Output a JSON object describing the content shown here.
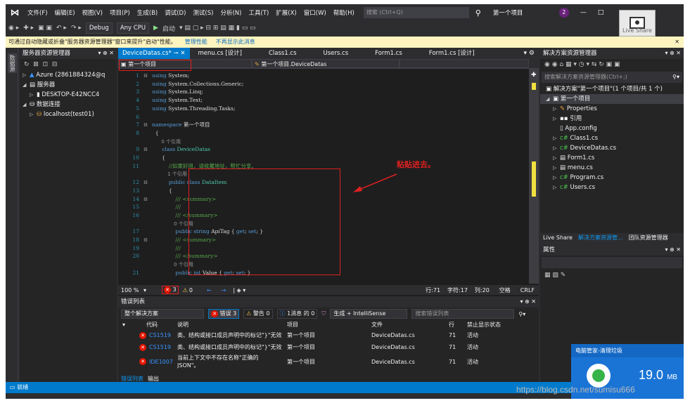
{
  "menubar": {
    "items": [
      "文件(F)",
      "编辑(E)",
      "视图(V)",
      "项目(P)",
      "生成(B)",
      "调试(D)",
      "测试(S)",
      "分析(N)",
      "工具(T)",
      "扩展(X)",
      "窗口(W)",
      "帮助(H)"
    ],
    "search_placeholder": "搜索 (Ctrl+Q)",
    "project_name": "第一个项目",
    "notification_count": "2",
    "live_share": "Live Share"
  },
  "toolbar": {
    "config": "Debug",
    "platform": "Any CPU",
    "start_label": "启动"
  },
  "infobar": {
    "message": "可通过自动隐藏或折叠\"服务器资源管理器\"窗口来提升\"启动\"性能。",
    "link1": "管理性能",
    "link2": "不再显示此消息"
  },
  "left_strip": {
    "tab_label": "数据源"
  },
  "server_explorer": {
    "title": "服务器资源管理器",
    "controls": "▾ ⊕ ✕",
    "items": [
      {
        "label": "Azure (2861884324@q",
        "expander": "▷"
      },
      {
        "label": "服务器",
        "expander": "◢"
      },
      {
        "label": "DESKTOP-E42NCC4",
        "expander": "▷"
      },
      {
        "label": "数据连接",
        "expander": "◢"
      },
      {
        "label": "localhost(test01)",
        "expander": "▷"
      }
    ]
  },
  "editor": {
    "tabs": [
      "DeviceDatas.cs*",
      "menu.cs [设计]",
      "Class1.cs",
      "Users.cs",
      "Form1.cs",
      "Form1.cs [设计]"
    ],
    "nav_project": "第一个项目",
    "nav_class": "第一个项目.DeviceDatas",
    "lines": [
      {
        "n": "1",
        "fold": "⊟",
        "parts": [
          [
            "kw",
            "using"
          ],
          [
            "plain",
            " System;"
          ]
        ]
      },
      {
        "n": "2",
        "fold": "",
        "parts": [
          [
            "kw",
            "using"
          ],
          [
            "plain",
            " System.Collections.Generic;"
          ]
        ]
      },
      {
        "n": "3",
        "fold": "",
        "parts": [
          [
            "kw",
            "using"
          ],
          [
            "plain",
            " System.Linq;"
          ]
        ]
      },
      {
        "n": "4",
        "fold": "",
        "parts": [
          [
            "kw",
            "using"
          ],
          [
            "plain",
            " System.Text;"
          ]
        ]
      },
      {
        "n": "5",
        "fold": "",
        "parts": [
          [
            "kw",
            "using"
          ],
          [
            "plain",
            " System.Threading.Tasks;"
          ]
        ]
      },
      {
        "n": "6",
        "fold": "",
        "parts": []
      },
      {
        "n": "7",
        "fold": "⊟",
        "parts": [
          [
            "kw",
            "namespace"
          ],
          [
            "plain",
            " 第一个项目"
          ]
        ]
      },
      {
        "n": "8",
        "fold": "",
        "parts": [
          [
            "plain",
            "  {"
          ]
        ]
      },
      {
        "n": "",
        "fold": "",
        "parts": [
          [
            "ref",
            "      0 个引用"
          ]
        ]
      },
      {
        "n": "9",
        "fold": "⊟",
        "parts": [
          [
            "plain",
            "      "
          ],
          [
            "kw",
            "class"
          ],
          [
            "plain",
            " "
          ],
          [
            "ty",
            "DeviceDatas"
          ]
        ]
      },
      {
        "n": "10",
        "fold": "",
        "parts": [
          [
            "plain",
            "      {"
          ]
        ]
      },
      {
        "n": "11",
        "fold": "",
        "parts": [
          [
            "cm",
            "          //如果好用，请收藏地址，帮忙分享。"
          ]
        ]
      },
      {
        "n": "",
        "fold": "",
        "parts": [
          [
            "ref",
            "          1 个引用"
          ]
        ]
      },
      {
        "n": "12",
        "fold": "⊟",
        "parts": [
          [
            "plain",
            "          "
          ],
          [
            "kw",
            "public class"
          ],
          [
            "plain",
            " "
          ],
          [
            "ty",
            "DataItem"
          ]
        ]
      },
      {
        "n": "13",
        "fold": "",
        "parts": [
          [
            "plain",
            "          {"
          ]
        ]
      },
      {
        "n": "14",
        "fold": "⊟",
        "parts": [
          [
            "cm",
            "              /// <summary>"
          ]
        ]
      },
      {
        "n": "15",
        "fold": "",
        "parts": [
          [
            "cm",
            "              ///"
          ]
        ]
      },
      {
        "n": "16",
        "fold": "",
        "parts": [
          [
            "cm",
            "              /// </summary>"
          ]
        ]
      },
      {
        "n": "",
        "fold": "",
        "parts": [
          [
            "ref",
            "              0 个引用"
          ]
        ]
      },
      {
        "n": "17",
        "fold": "",
        "parts": [
          [
            "plain",
            "              "
          ],
          [
            "kw",
            "public string"
          ],
          [
            "plain",
            " ApiTag { "
          ],
          [
            "kw",
            "get"
          ],
          [
            "plain",
            "; "
          ],
          [
            "kw",
            "set"
          ],
          [
            "plain",
            "; }"
          ]
        ]
      },
      {
        "n": "18",
        "fold": "⊟",
        "parts": [
          [
            "cm",
            "              /// <summary>"
          ]
        ]
      },
      {
        "n": "19",
        "fold": "",
        "parts": [
          [
            "cm",
            "              ///"
          ]
        ]
      },
      {
        "n": "20",
        "fold": "",
        "parts": [
          [
            "cm",
            "              /// </summary>"
          ]
        ]
      },
      {
        "n": "",
        "fold": "",
        "parts": [
          [
            "ref",
            "              0 个引用"
          ]
        ]
      },
      {
        "n": "21",
        "fold": "",
        "parts": [
          [
            "plain",
            "              "
          ],
          [
            "kw",
            "public int"
          ],
          [
            "plain",
            " Value { "
          ],
          [
            "kw",
            "get"
          ],
          [
            "plain",
            "; "
          ],
          [
            "kw",
            "set"
          ],
          [
            "plain",
            "; }"
          ]
        ]
      }
    ],
    "annotation": "粘贴进去。",
    "zoom": "100 %",
    "error_count": "3",
    "warning_count": "0",
    "row": "行:71",
    "char": "字符:17",
    "col": "列:20",
    "ins": "空格",
    "eol": "CRLF"
  },
  "solution_explorer": {
    "title": "解决方案资源管理器",
    "search_placeholder": "搜索解决方案资源管理器(Ctrl+;)",
    "solution_label": "解决方案\"第一个项目\"(1 个项目/共 1 个)",
    "project": "第一个项目",
    "items": [
      "Properties",
      "引用",
      "App.config",
      "Class1.cs",
      "DeviceDatas.cs",
      "Form1.cs",
      "menu.cs",
      "Program.cs",
      "Users.cs"
    ],
    "tabs": [
      "Live Share",
      "解决方案资源管...",
      "团队资源管理器"
    ]
  },
  "properties": {
    "title": "属性"
  },
  "error_list": {
    "title": "错误列表",
    "scope": "整个解决方案",
    "errors_btn": "错误 3",
    "warnings_btn": "警告 0",
    "messages_btn": "1消息 的 0",
    "build_filter": "生成 + IntelliSense",
    "search_placeholder": "搜索错误列表",
    "headers": [
      "代码",
      "说明",
      "项目",
      "文件",
      "行",
      "禁止显示状态"
    ],
    "rows": [
      {
        "code": "CS1519",
        "desc": "类、结构或接口成员声明中的标记\"}\"无效",
        "project": "第一个项目",
        "file": "DeviceDatas.cs",
        "line": "71",
        "state": "活动"
      },
      {
        "code": "CS1519",
        "desc": "类、结构或接口成员声明中的标记\"}\"无效",
        "project": "第一个项目",
        "file": "DeviceDatas.cs",
        "line": "71",
        "state": "活动"
      },
      {
        "code": "IDE1007",
        "desc": "当前上下文中不存在名称\"正确的 JSON\"。",
        "project": "第一个项目",
        "file": "DeviceDatas.cs",
        "line": "71",
        "state": "活动"
      }
    ],
    "bottom_tabs": [
      "错误列表",
      "输出"
    ]
  },
  "statusbar": {
    "text": "就绪"
  },
  "pc_manager": {
    "title": "电脑管家-清理垃圾",
    "size": "19.0",
    "unit": "MB"
  },
  "watermark": "https://blog.csdn.net/sumisu666",
  "colors": {
    "accent": "#007acc",
    "annotation": "#e02020"
  }
}
